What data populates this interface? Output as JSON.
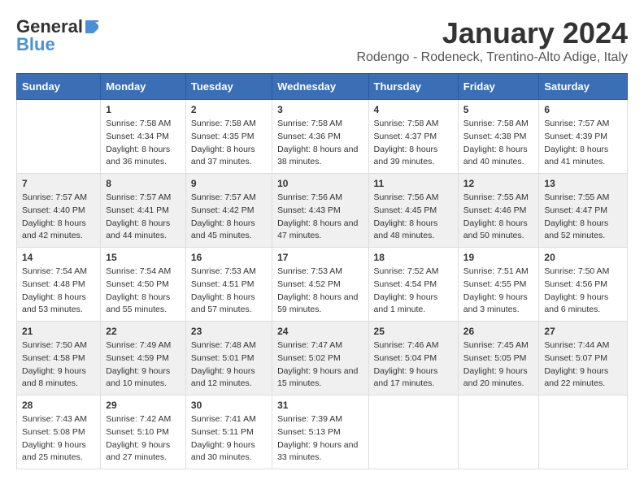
{
  "logo": {
    "general": "General",
    "blue": "Blue"
  },
  "title": "January 2024",
  "location": "Rodengo - Rodeneck, Trentino-Alto Adige, Italy",
  "days_of_week": [
    "Sunday",
    "Monday",
    "Tuesday",
    "Wednesday",
    "Thursday",
    "Friday",
    "Saturday"
  ],
  "weeks": [
    [
      {
        "day": "",
        "sunrise": "",
        "sunset": "",
        "daylight": ""
      },
      {
        "day": "1",
        "sunrise": "Sunrise: 7:58 AM",
        "sunset": "Sunset: 4:34 PM",
        "daylight": "Daylight: 8 hours and 36 minutes."
      },
      {
        "day": "2",
        "sunrise": "Sunrise: 7:58 AM",
        "sunset": "Sunset: 4:35 PM",
        "daylight": "Daylight: 8 hours and 37 minutes."
      },
      {
        "day": "3",
        "sunrise": "Sunrise: 7:58 AM",
        "sunset": "Sunset: 4:36 PM",
        "daylight": "Daylight: 8 hours and 38 minutes."
      },
      {
        "day": "4",
        "sunrise": "Sunrise: 7:58 AM",
        "sunset": "Sunset: 4:37 PM",
        "daylight": "Daylight: 8 hours and 39 minutes."
      },
      {
        "day": "5",
        "sunrise": "Sunrise: 7:58 AM",
        "sunset": "Sunset: 4:38 PM",
        "daylight": "Daylight: 8 hours and 40 minutes."
      },
      {
        "day": "6",
        "sunrise": "Sunrise: 7:57 AM",
        "sunset": "Sunset: 4:39 PM",
        "daylight": "Daylight: 8 hours and 41 minutes."
      }
    ],
    [
      {
        "day": "7",
        "sunrise": "Sunrise: 7:57 AM",
        "sunset": "Sunset: 4:40 PM",
        "daylight": "Daylight: 8 hours and 42 minutes."
      },
      {
        "day": "8",
        "sunrise": "Sunrise: 7:57 AM",
        "sunset": "Sunset: 4:41 PM",
        "daylight": "Daylight: 8 hours and 44 minutes."
      },
      {
        "day": "9",
        "sunrise": "Sunrise: 7:57 AM",
        "sunset": "Sunset: 4:42 PM",
        "daylight": "Daylight: 8 hours and 45 minutes."
      },
      {
        "day": "10",
        "sunrise": "Sunrise: 7:56 AM",
        "sunset": "Sunset: 4:43 PM",
        "daylight": "Daylight: 8 hours and 47 minutes."
      },
      {
        "day": "11",
        "sunrise": "Sunrise: 7:56 AM",
        "sunset": "Sunset: 4:45 PM",
        "daylight": "Daylight: 8 hours and 48 minutes."
      },
      {
        "day": "12",
        "sunrise": "Sunrise: 7:55 AM",
        "sunset": "Sunset: 4:46 PM",
        "daylight": "Daylight: 8 hours and 50 minutes."
      },
      {
        "day": "13",
        "sunrise": "Sunrise: 7:55 AM",
        "sunset": "Sunset: 4:47 PM",
        "daylight": "Daylight: 8 hours and 52 minutes."
      }
    ],
    [
      {
        "day": "14",
        "sunrise": "Sunrise: 7:54 AM",
        "sunset": "Sunset: 4:48 PM",
        "daylight": "Daylight: 8 hours and 53 minutes."
      },
      {
        "day": "15",
        "sunrise": "Sunrise: 7:54 AM",
        "sunset": "Sunset: 4:50 PM",
        "daylight": "Daylight: 8 hours and 55 minutes."
      },
      {
        "day": "16",
        "sunrise": "Sunrise: 7:53 AM",
        "sunset": "Sunset: 4:51 PM",
        "daylight": "Daylight: 8 hours and 57 minutes."
      },
      {
        "day": "17",
        "sunrise": "Sunrise: 7:53 AM",
        "sunset": "Sunset: 4:52 PM",
        "daylight": "Daylight: 8 hours and 59 minutes."
      },
      {
        "day": "18",
        "sunrise": "Sunrise: 7:52 AM",
        "sunset": "Sunset: 4:54 PM",
        "daylight": "Daylight: 9 hours and 1 minute."
      },
      {
        "day": "19",
        "sunrise": "Sunrise: 7:51 AM",
        "sunset": "Sunset: 4:55 PM",
        "daylight": "Daylight: 9 hours and 3 minutes."
      },
      {
        "day": "20",
        "sunrise": "Sunrise: 7:50 AM",
        "sunset": "Sunset: 4:56 PM",
        "daylight": "Daylight: 9 hours and 6 minutes."
      }
    ],
    [
      {
        "day": "21",
        "sunrise": "Sunrise: 7:50 AM",
        "sunset": "Sunset: 4:58 PM",
        "daylight": "Daylight: 9 hours and 8 minutes."
      },
      {
        "day": "22",
        "sunrise": "Sunrise: 7:49 AM",
        "sunset": "Sunset: 4:59 PM",
        "daylight": "Daylight: 9 hours and 10 minutes."
      },
      {
        "day": "23",
        "sunrise": "Sunrise: 7:48 AM",
        "sunset": "Sunset: 5:01 PM",
        "daylight": "Daylight: 9 hours and 12 minutes."
      },
      {
        "day": "24",
        "sunrise": "Sunrise: 7:47 AM",
        "sunset": "Sunset: 5:02 PM",
        "daylight": "Daylight: 9 hours and 15 minutes."
      },
      {
        "day": "25",
        "sunrise": "Sunrise: 7:46 AM",
        "sunset": "Sunset: 5:04 PM",
        "daylight": "Daylight: 9 hours and 17 minutes."
      },
      {
        "day": "26",
        "sunrise": "Sunrise: 7:45 AM",
        "sunset": "Sunset: 5:05 PM",
        "daylight": "Daylight: 9 hours and 20 minutes."
      },
      {
        "day": "27",
        "sunrise": "Sunrise: 7:44 AM",
        "sunset": "Sunset: 5:07 PM",
        "daylight": "Daylight: 9 hours and 22 minutes."
      }
    ],
    [
      {
        "day": "28",
        "sunrise": "Sunrise: 7:43 AM",
        "sunset": "Sunset: 5:08 PM",
        "daylight": "Daylight: 9 hours and 25 minutes."
      },
      {
        "day": "29",
        "sunrise": "Sunrise: 7:42 AM",
        "sunset": "Sunset: 5:10 PM",
        "daylight": "Daylight: 9 hours and 27 minutes."
      },
      {
        "day": "30",
        "sunrise": "Sunrise: 7:41 AM",
        "sunset": "Sunset: 5:11 PM",
        "daylight": "Daylight: 9 hours and 30 minutes."
      },
      {
        "day": "31",
        "sunrise": "Sunrise: 7:39 AM",
        "sunset": "Sunset: 5:13 PM",
        "daylight": "Daylight: 9 hours and 33 minutes."
      },
      {
        "day": "",
        "sunrise": "",
        "sunset": "",
        "daylight": ""
      },
      {
        "day": "",
        "sunrise": "",
        "sunset": "",
        "daylight": ""
      },
      {
        "day": "",
        "sunrise": "",
        "sunset": "",
        "daylight": ""
      }
    ]
  ]
}
